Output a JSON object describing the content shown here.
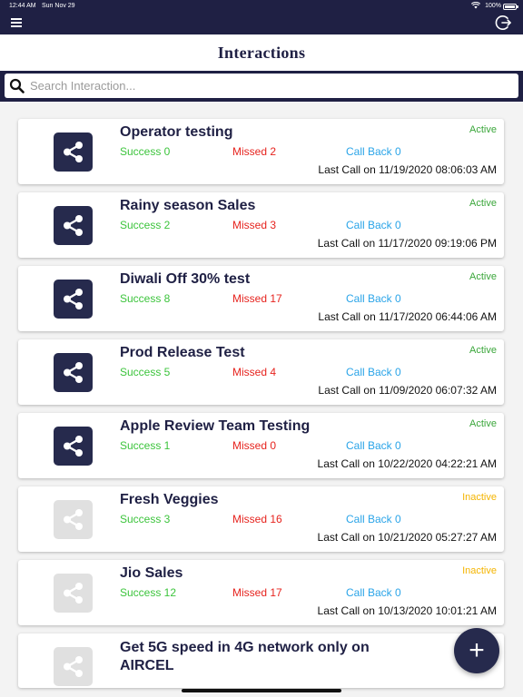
{
  "status_bar": {
    "time": "12:44 AM",
    "date": "Sun Nov 29",
    "battery": "100%"
  },
  "header": {
    "menu_icon": "hamburger-icon",
    "logout_icon": "logout-icon",
    "title": "Interactions"
  },
  "search": {
    "placeholder": "Search Interaction...",
    "value": ""
  },
  "interactions": [
    {
      "name": "Operator testing",
      "status": "Active",
      "success": "Success 0",
      "missed": "Missed 2",
      "callback": "Call Back 0",
      "last_call": "Last Call on 11/19/2020 08:06:03 AM"
    },
    {
      "name": "Rainy season Sales",
      "status": "Active",
      "success": "Success 2",
      "missed": "Missed 3",
      "callback": "Call Back 0",
      "last_call": "Last Call on 11/17/2020 09:19:06 PM"
    },
    {
      "name": "Diwali Off 30% test",
      "status": "Active",
      "success": "Success 8",
      "missed": "Missed 17",
      "callback": "Call Back 0",
      "last_call": "Last Call on 11/17/2020 06:44:06 AM"
    },
    {
      "name": "Prod Release Test",
      "status": "Active",
      "success": "Success 5",
      "missed": "Missed 4",
      "callback": "Call Back 0",
      "last_call": "Last Call on 11/09/2020 06:07:32 AM"
    },
    {
      "name": "Apple Review Team Testing",
      "status": "Active",
      "success": "Success 1",
      "missed": "Missed 0",
      "callback": "Call Back 0",
      "last_call": "Last Call on 10/22/2020 04:22:21 AM"
    },
    {
      "name": "Fresh Veggies",
      "status": "Inactive",
      "success": "Success 3",
      "missed": "Missed 16",
      "callback": "Call Back 0",
      "last_call": "Last Call on 10/21/2020 05:27:27 AM"
    },
    {
      "name": "Jio Sales",
      "status": "Inactive",
      "success": "Success 12",
      "missed": "Missed 17",
      "callback": "Call Back 0",
      "last_call": "Last Call on 10/13/2020 10:01:21 AM"
    },
    {
      "name": "Get 5G speed in 4G network only on AIRCEL",
      "status": "",
      "success": "",
      "missed": "",
      "callback": "",
      "last_call": ""
    }
  ],
  "colors": {
    "navy": "#1f2044",
    "active": "#3aa63a",
    "inactive": "#f4b400",
    "success": "#3cc43c",
    "missed": "#e6231e",
    "callback": "#2aa4e8"
  },
  "fab": {
    "label": "+",
    "icon": "plus-icon"
  }
}
